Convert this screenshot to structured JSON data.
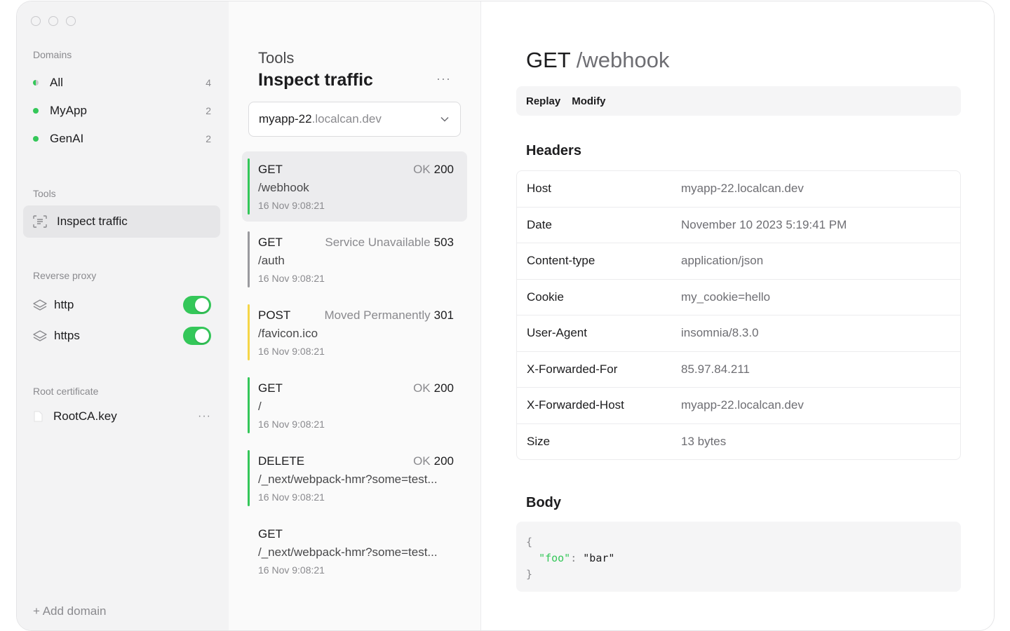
{
  "sidebar": {
    "domains_title": "Domains",
    "domains": [
      {
        "label": "All",
        "count": "4"
      },
      {
        "label": "MyApp",
        "count": "2"
      },
      {
        "label": "GenAI",
        "count": "2"
      }
    ],
    "tools_title": "Tools",
    "tool_item": "Inspect traffic",
    "proxy_title": "Reverse proxy",
    "proxies": [
      {
        "label": "http",
        "enabled": true
      },
      {
        "label": "https",
        "enabled": true
      }
    ],
    "cert_title": "Root certificate",
    "cert_item": "RootCA.key",
    "cert_more": "···",
    "add_domain": "+ Add domain"
  },
  "middle": {
    "subtitle": "Tools",
    "title": "Inspect traffic",
    "more": "···",
    "select": {
      "subdomain": "myapp-22",
      "domain": ".localcan.dev"
    },
    "requests": [
      {
        "method": "GET",
        "status_text": "OK",
        "status_code": "200",
        "path": "/webhook",
        "time": "16 Nov 9:08:21",
        "bar_color": "#34c759"
      },
      {
        "method": "GET",
        "status_text": "Service Unavailable",
        "status_code": "503",
        "path": "/auth",
        "time": "16 Nov 9:08:21",
        "bar_color": "#9a9a9e"
      },
      {
        "method": "POST",
        "status_text": "Moved Permanently",
        "status_code": "301",
        "path": "/favicon.ico",
        "time": "16 Nov 9:08:21",
        "bar_color": "#f5d547"
      },
      {
        "method": "GET",
        "status_text": "OK",
        "status_code": "200",
        "path": "/",
        "time": "16 Nov 9:08:21",
        "bar_color": "#34c759"
      },
      {
        "method": "DELETE",
        "status_text": "OK",
        "status_code": "200",
        "path": "/_next/webpack-hmr?some=test...",
        "time": "16 Nov 9:08:21",
        "bar_color": "#34c759"
      },
      {
        "method": "GET",
        "status_text": "",
        "status_code": "",
        "path": "/_next/webpack-hmr?some=test...",
        "time": "16 Nov 9:08:21",
        "bar_color": ""
      }
    ]
  },
  "detail": {
    "method": "GET",
    "path": "/webhook",
    "actions": [
      "Replay",
      "Modify"
    ],
    "headers_title": "Headers",
    "headers": [
      {
        "key": "Host",
        "value": "myapp-22.localcan.dev"
      },
      {
        "key": "Date",
        "value": "November 10 2023 5:19:41 PM"
      },
      {
        "key": "Content-type",
        "value": "application/json"
      },
      {
        "key": "Cookie",
        "value": "my_cookie=hello"
      },
      {
        "key": "User-Agent",
        "value": "insomnia/8.3.0"
      },
      {
        "key": "X-Forwarded-For",
        "value": "85.97.84.211"
      },
      {
        "key": "X-Forwarded-Host",
        "value": "myapp-22.localcan.dev"
      },
      {
        "key": "Size",
        "value": "13 bytes"
      }
    ],
    "body_title": "Body",
    "body": {
      "open": "{",
      "key": "\"foo\"",
      "colon": ":",
      "value": "\"bar\"",
      "close": "}"
    }
  },
  "colors": {
    "accent": "#34c759"
  }
}
